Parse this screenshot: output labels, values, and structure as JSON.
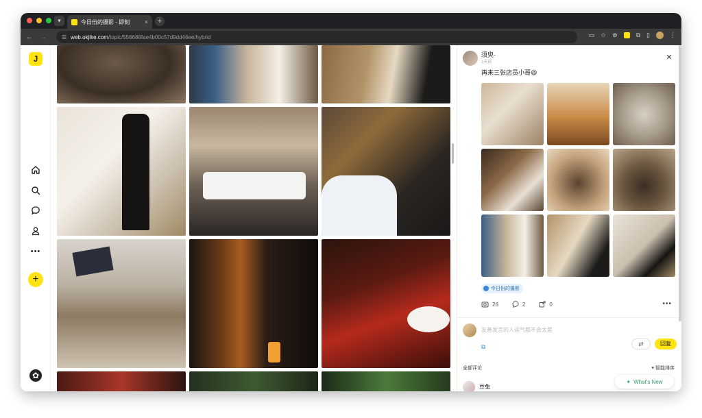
{
  "browser": {
    "tab_title": "今日份的摄影 - 即刻",
    "tab_close": "×",
    "newtab": "+",
    "url_host": "web.okjike.com",
    "url_path": "/topic/556688fae4b00c57d9dd46ee/hybrid",
    "back": "←",
    "forward": "→",
    "reload": "⟳"
  },
  "sidebar": {
    "logo": "J",
    "add": "+",
    "settings": "✿"
  },
  "post": {
    "author": "须臾-",
    "time": "1天前",
    "text": "再来三张店员小哥😆",
    "close": "✕",
    "topic": "今日份的摄影",
    "likes": "26",
    "comments": "2",
    "shares": "0",
    "more": "•••"
  },
  "comment_box": {
    "placeholder": "友善发言的人运气都不会太差",
    "reply": "回复",
    "refresh": "⇄"
  },
  "comments": {
    "section_title": "全部评论",
    "sort_label": "▾ 智能排序",
    "first_author": "豆兔"
  },
  "whatsnew": "What's New",
  "colors": {
    "accent": "#ffe411",
    "link": "#3b88d8"
  }
}
